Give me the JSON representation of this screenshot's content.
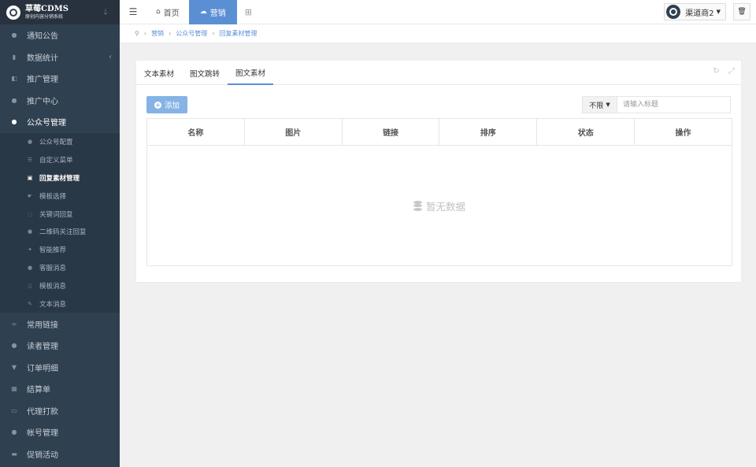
{
  "app": {
    "logo_title": "草莓CDMS",
    "logo_subtitle": "原创内容分销系统"
  },
  "sidebar": {
    "items": [
      {
        "label": "通知公告",
        "icon": "comment-icon"
      },
      {
        "label": "数据统计",
        "icon": "bar-chart-icon",
        "has_chevron": true
      },
      {
        "label": "推广管理",
        "icon": "share-icon"
      },
      {
        "label": "推广中心",
        "icon": "user-icon"
      },
      {
        "label": "公众号管理",
        "icon": "wechat-icon",
        "active": true
      }
    ],
    "sub_items": [
      {
        "label": "公众号配置",
        "icon": "wechat-icon"
      },
      {
        "label": "自定义菜单",
        "icon": "list-icon"
      },
      {
        "label": "回复素材管理",
        "icon": "image-icon",
        "active": true
      },
      {
        "label": "模板选择",
        "icon": "hand-icon"
      },
      {
        "label": "关键词回复",
        "icon": "chat-icon"
      },
      {
        "label": "二维码关注回复",
        "icon": "comment-icon"
      },
      {
        "label": "智能推荐",
        "icon": "magic-icon"
      },
      {
        "label": "客服消息",
        "icon": "user-icon"
      },
      {
        "label": "模板消息",
        "icon": "file-icon"
      },
      {
        "label": "文本消息",
        "icon": "edit-icon"
      }
    ],
    "items_after": [
      {
        "label": "常用链接",
        "icon": "link-icon"
      },
      {
        "label": "读者管理",
        "icon": "users-icon"
      },
      {
        "label": "订单明细",
        "icon": "cart-icon"
      },
      {
        "label": "结算单",
        "icon": "calculator-icon"
      },
      {
        "label": "代理打款",
        "icon": "keyboard-icon"
      },
      {
        "label": "帐号管理",
        "icon": "user-plus-icon"
      },
      {
        "label": "促销活动",
        "icon": "briefcase-icon"
      }
    ]
  },
  "topbar": {
    "tabs": [
      {
        "label": "首页",
        "icon": "home-icon"
      },
      {
        "label": "营销",
        "icon": "cloud-icon",
        "active": true
      }
    ],
    "user_name": "渠道商2"
  },
  "breadcrumb": {
    "items": [
      "营销",
      "公众号管理",
      "回复素材管理"
    ]
  },
  "content": {
    "tabs": [
      {
        "label": "文本素材"
      },
      {
        "label": "图文跳转"
      },
      {
        "label": "图文素材",
        "active": true
      }
    ],
    "add_button_label": "添加",
    "filter_value": "不限",
    "search_placeholder": "请输入标题",
    "table": {
      "columns": [
        "名称",
        "图片",
        "链接",
        "排序",
        "状态",
        "操作"
      ],
      "empty_text": "暂无数据"
    }
  },
  "colors": {
    "sidebar_bg": "#2f4050",
    "accent": "#5b8fd4",
    "add_button": "#85b3e5"
  }
}
